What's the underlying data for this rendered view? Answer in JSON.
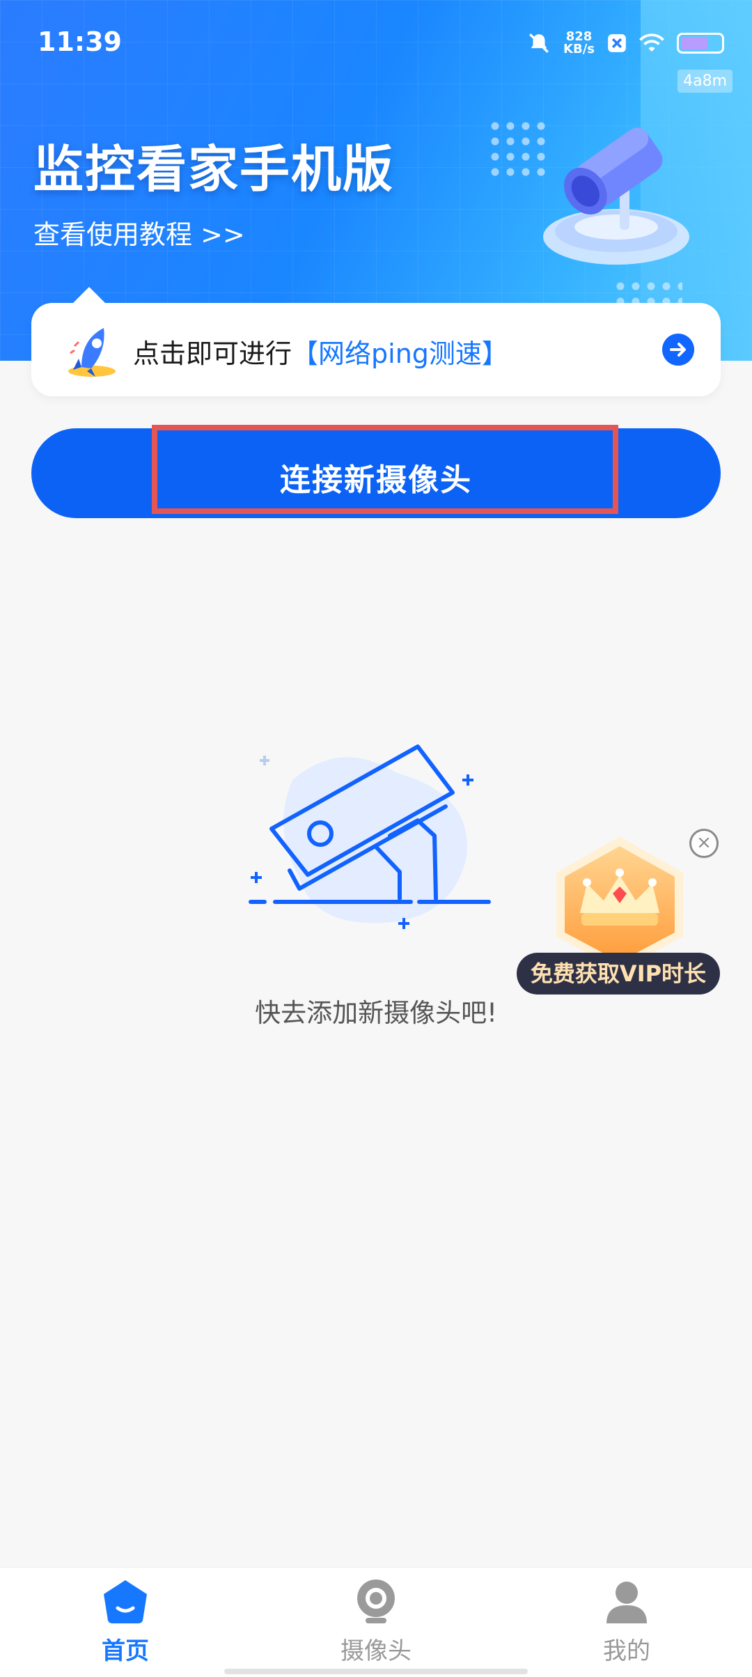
{
  "status_bar": {
    "time": "11:39",
    "speed_value": "828",
    "speed_unit": "KB/s",
    "tag": "4a8m"
  },
  "hero": {
    "title": "监控看家手机版",
    "subtitle": "查看使用教程 >>"
  },
  "ping_card": {
    "text_prefix": "点击即可进行",
    "text_highlight": "【网络ping测速】"
  },
  "connect_button": {
    "label": "连接新摄像头"
  },
  "empty_state": {
    "message": "快去添加新摄像头吧!"
  },
  "vip_promo": {
    "label": "免费获取VIP时长",
    "close_icon": "close-icon"
  },
  "tabbar": {
    "tabs": [
      {
        "label": "首页",
        "icon": "home-icon",
        "active": true
      },
      {
        "label": "摄像头",
        "icon": "camera-icon",
        "active": false
      },
      {
        "label": "我的",
        "icon": "profile-icon",
        "active": false
      }
    ]
  },
  "colors": {
    "accent": "#1677ff",
    "button": "#0b62f5",
    "highlight_box": "#e45656"
  }
}
